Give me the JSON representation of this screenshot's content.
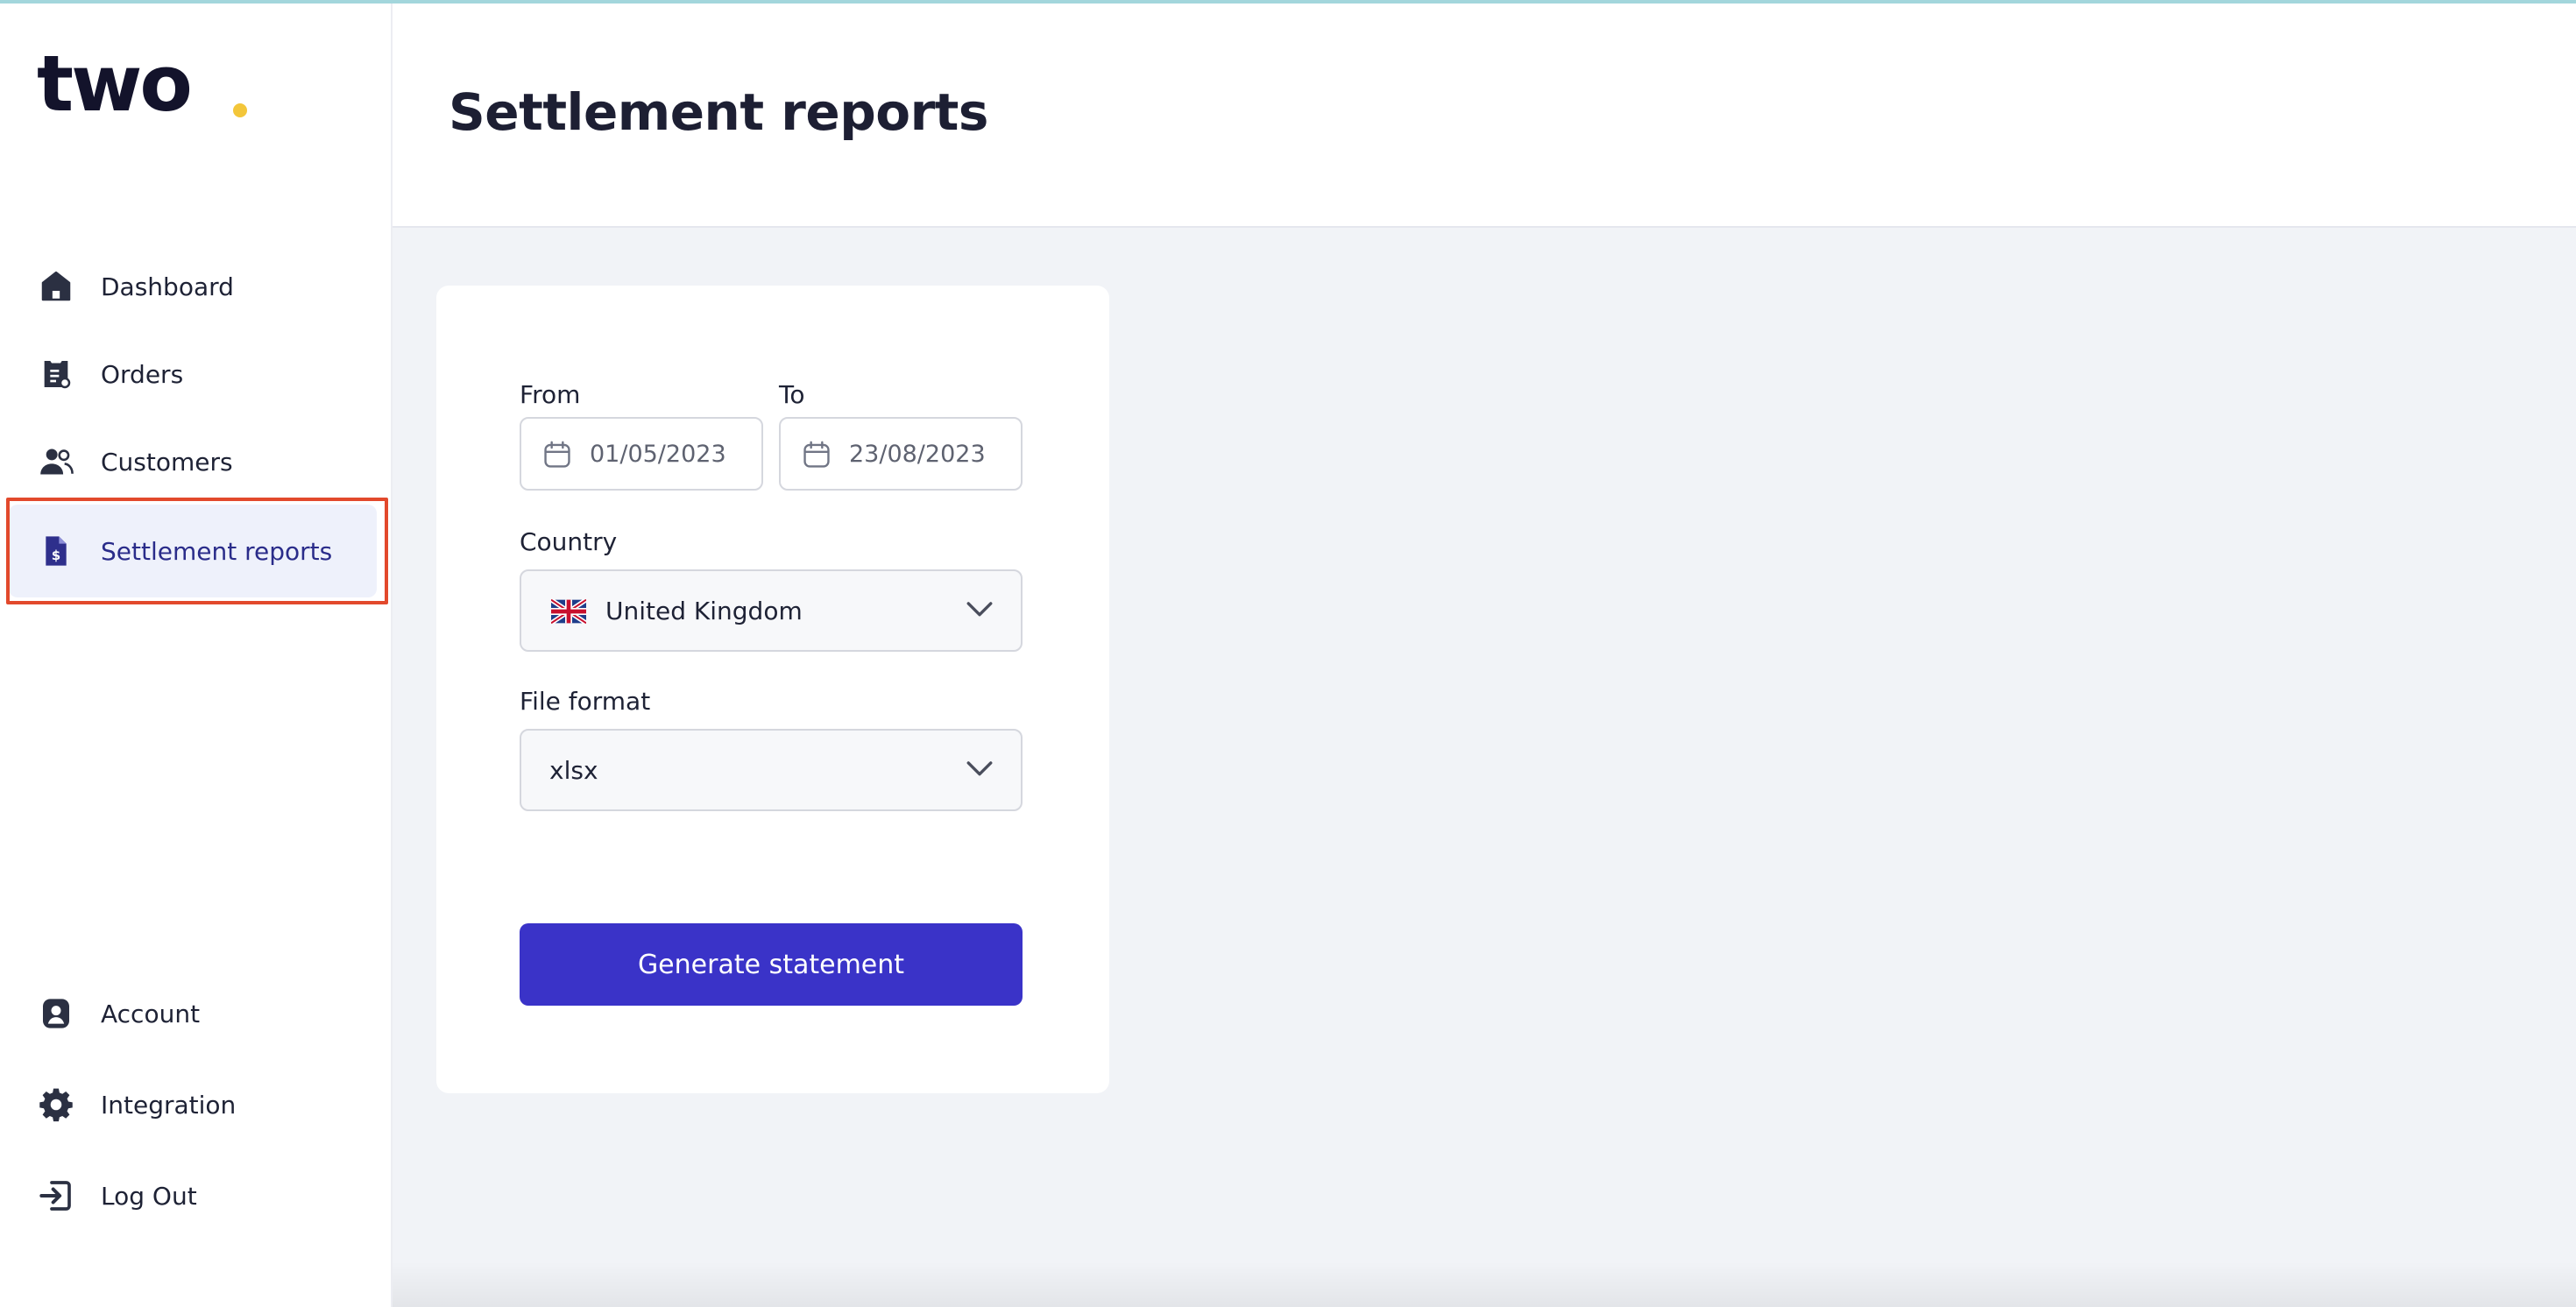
{
  "logo": {
    "text": "two",
    "dot_color": "#f3c63a"
  },
  "sidebar": {
    "items": [
      {
        "label": "Dashboard",
        "icon": "home-icon"
      },
      {
        "label": "Orders",
        "icon": "orders-icon"
      },
      {
        "label": "Customers",
        "icon": "customers-icon"
      },
      {
        "label": "Settlement reports",
        "icon": "settlement-icon",
        "active": true
      }
    ],
    "bottom_items": [
      {
        "label": "Account",
        "icon": "account-icon"
      },
      {
        "label": "Integration",
        "icon": "gear-icon"
      },
      {
        "label": "Log Out",
        "icon": "logout-icon"
      }
    ]
  },
  "header": {
    "title": "Settlement reports"
  },
  "form": {
    "from_label": "From",
    "from_value": "01/05/2023",
    "to_label": "To",
    "to_value": "23/08/2023",
    "country_label": "Country",
    "country_value": "United Kingdom",
    "country_flag": "uk-flag-icon",
    "format_label": "File format",
    "format_value": "xlsx",
    "submit_label": "Generate statement"
  },
  "colors": {
    "accent": "#3a33c8",
    "active_bg": "#eef1fb",
    "highlight_border": "#e2492c",
    "page_bg": "#f1f3f7"
  }
}
